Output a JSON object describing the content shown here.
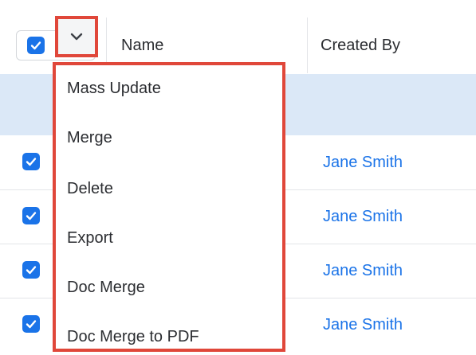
{
  "table": {
    "columns": [
      "Name",
      "Created By"
    ],
    "rows": [
      {
        "created_by": "Jane Smith",
        "checked": true
      },
      {
        "created_by": "Jane Smith",
        "checked": true
      },
      {
        "created_by": "Jane Smith",
        "checked": true
      },
      {
        "created_by": "Jane Smith",
        "checked": true
      }
    ]
  },
  "select_all": {
    "checked": true,
    "icon": "checkmark-icon"
  },
  "actions_toggle": {
    "icon": "chevron-down-icon"
  },
  "actions_menu": {
    "items": [
      "Mass Update",
      "Merge",
      "Delete",
      "Export",
      "Doc Merge",
      "Doc Merge to PDF"
    ]
  },
  "colors": {
    "accent": "#1a73e8",
    "highlight_border": "#e0473a",
    "selected_band": "#dbe8f7"
  }
}
